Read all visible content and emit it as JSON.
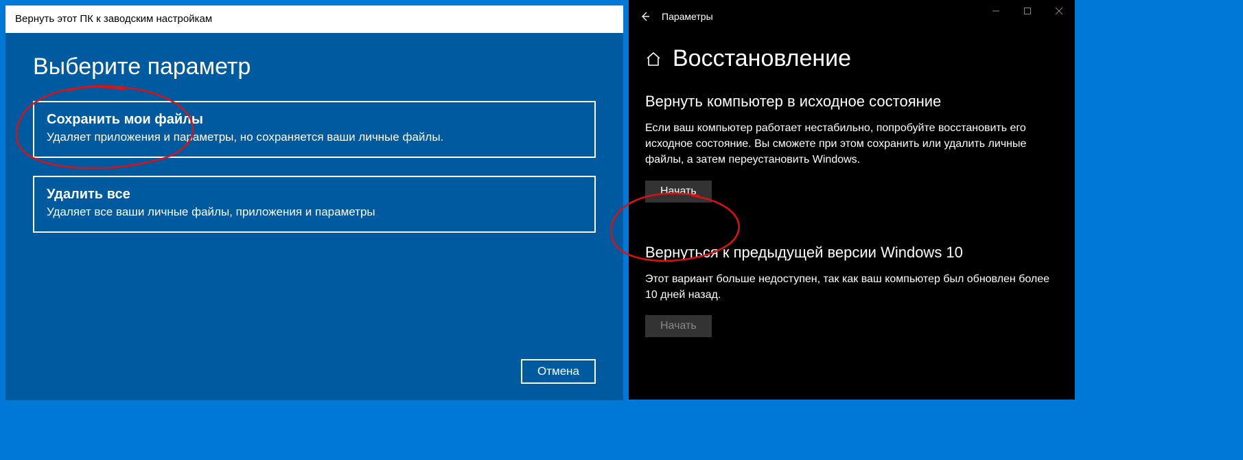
{
  "reset": {
    "window_title": "Вернуть этот ПК к заводским настройкам",
    "heading": "Выберите параметр",
    "options": [
      {
        "title": "Сохранить мои файлы",
        "desc": "Удаляет приложения и параметры, но сохраняется ваши личные файлы."
      },
      {
        "title": "Удалить все",
        "desc": "Удаляет все ваши личные файлы, приложения и параметры"
      }
    ],
    "cancel": "Отмена"
  },
  "settings": {
    "app_title": "Параметры",
    "page_heading": "Восстановление",
    "section1": {
      "title": "Вернуть компьютер в исходное состояние",
      "desc": "Если ваш компьютер работает нестабильно, попробуйте восстановить его исходное состояние. Вы сможете при этом сохранить или удалить личные файлы, а затем переустановить Windows.",
      "button": "Начать"
    },
    "section2": {
      "title": "Вернуться к предыдущей версии Windows 10",
      "desc": "Этот вариант больше недоступен, так как ваш компьютер был обновлен более 10 дней назад.",
      "button": "Начать"
    }
  }
}
